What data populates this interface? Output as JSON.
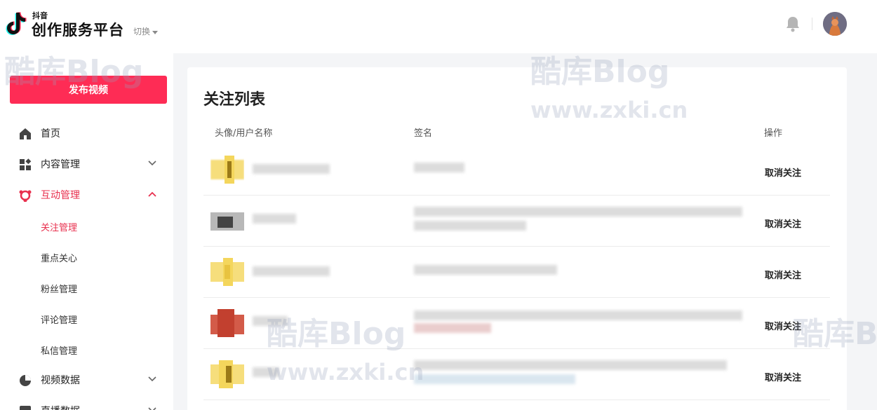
{
  "header": {
    "logo_small": "抖音",
    "logo_title": "创作服务平台",
    "switch_label": "切换"
  },
  "sidebar": {
    "publish_button": "发布视频",
    "items": [
      {
        "label": "首页",
        "icon": "home-icon"
      },
      {
        "label": "内容管理",
        "icon": "content-grid-icon"
      },
      {
        "label": "互动管理",
        "icon": "interaction-icon"
      },
      {
        "label": "视频数据",
        "icon": "pie-chart-icon"
      },
      {
        "label": "直播数据",
        "icon": "live-data-icon"
      }
    ],
    "sub_items": [
      {
        "label": "关注管理"
      },
      {
        "label": "重点关心"
      },
      {
        "label": "粉丝管理"
      },
      {
        "label": "评论管理"
      },
      {
        "label": "私信管理"
      }
    ]
  },
  "main": {
    "title": "关注列表",
    "columns": [
      "头像/用户名称",
      "签名",
      "操作"
    ],
    "rows": [
      {
        "action": "取消关注"
      },
      {
        "action": "取消关注"
      },
      {
        "action": "取消关注"
      },
      {
        "action": "取消关注"
      },
      {
        "action": "取消关注"
      }
    ]
  },
  "watermark": {
    "brand": "酷库Blog",
    "url": "www.zxki.cn"
  },
  "colors": {
    "accent": "#fe2c55",
    "active_text": "#e8304e"
  }
}
